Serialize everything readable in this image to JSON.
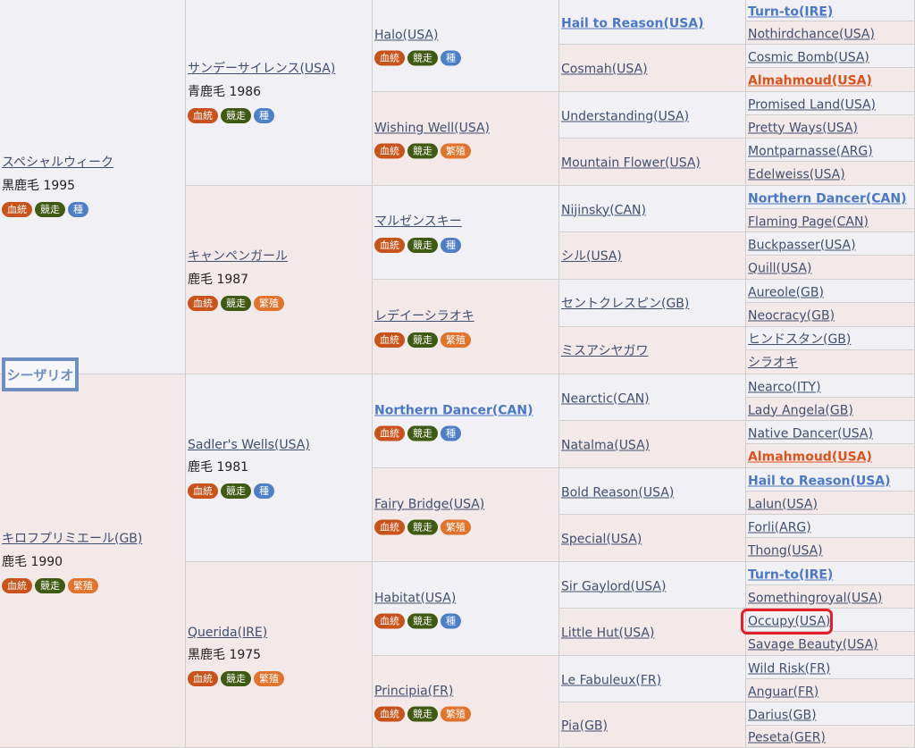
{
  "subject": "シーザリオ",
  "tags": {
    "blood": "血統",
    "race": "競走",
    "stud": "種",
    "breed": "繁殖"
  },
  "gen1": [
    {
      "name": "スペシャルウィーク",
      "coat": "黒鹿毛 1995"
    },
    {
      "name": "キロフプリミエール(GB)",
      "coat": "鹿毛 1990"
    }
  ],
  "gen2": [
    {
      "name": "サンデーサイレンス(USA)",
      "coat": "青鹿毛 1986"
    },
    {
      "name": "キャンペンガール",
      "coat": "鹿毛 1987"
    },
    {
      "name": "Sadler's Wells(USA)",
      "coat": "鹿毛 1981"
    },
    {
      "name": "Querida(IRE)",
      "coat": "黒鹿毛 1975"
    }
  ],
  "gen3": [
    {
      "name": "Halo(USA)"
    },
    {
      "name": "Wishing Well(USA)"
    },
    {
      "name": "マルゼンスキー"
    },
    {
      "name": "レデイーシラオキ"
    },
    {
      "name": "Northern Dancer(CAN)"
    },
    {
      "name": "Fairy Bridge(USA)"
    },
    {
      "name": "Habitat(USA)"
    },
    {
      "name": "Principia(FR)"
    }
  ],
  "gen4": [
    "Hail to Reason(USA)",
    "Cosmah(USA)",
    "Understanding(USA)",
    "Mountain Flower(USA)",
    "Nijinsky(CAN)",
    "シル(USA)",
    "セントクレスピン(GB)",
    "ミスアシヤガワ",
    "Nearctic(CAN)",
    "Natalma(USA)",
    "Bold Reason(USA)",
    "Special(USA)",
    "Sir Gaylord(USA)",
    "Little Hut(USA)",
    "Le Fabuleux(FR)",
    "Pia(GB)"
  ],
  "gen5": [
    "Turn-to(IRE)",
    "Nothirdchance(USA)",
    "Cosmic Bomb(USA)",
    "Almahmoud(USA)",
    "Promised Land(USA)",
    "Pretty Ways(USA)",
    "Montparnasse(ARG)",
    "Edelweiss(USA)",
    "Northern Dancer(CAN)",
    "Flaming Page(CAN)",
    "Buckpasser(USA)",
    "Quill(USA)",
    "Aureole(GB)",
    "Neocracy(GB)",
    "ヒンドスタン(GB)",
    "シラオキ",
    "Nearco(ITY)",
    "Lady Angela(GB)",
    "Native Dancer(USA)",
    "Almahmoud(USA)",
    "Hail to Reason(USA)",
    "Lalun(USA)",
    "Forli(ARG)",
    "Thong(USA)",
    "Turn-to(IRE)",
    "Somethingroyal(USA)",
    "Occupy(USA)",
    "Savage Beauty(USA)",
    "Wild Risk(FR)",
    "Anguar(FR)",
    "Darius(GB)",
    "Peseta(GER)"
  ]
}
